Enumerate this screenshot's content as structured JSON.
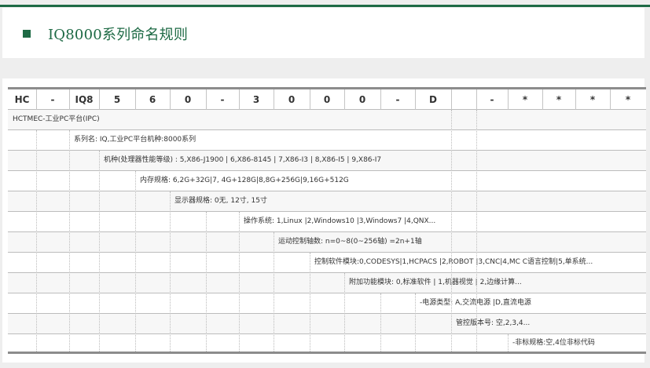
{
  "title": "IQ8000系列命名规则",
  "header_codes": [
    "HC",
    "-",
    "IQ8",
    "5",
    "6",
    "0",
    "-",
    "3",
    "0",
    "0",
    "0",
    "-",
    "D",
    "",
    "-",
    "*",
    "*",
    "*",
    "*"
  ],
  "descriptions": [
    "HCTMEC-工业PC平台(IPC)",
    "系列名: IQ,工业PC平台机种:8000系列",
    "机种(处理器性能等级) : 5,X86-J1900 | 6,X86-8145 | 7,X86-I3 | 8,X86-I5 | 9,X86-I7",
    "内存规格: 6,2G+32G|7, 4G+128G|8,8G+256G|9,16G+512G",
    "显示器规格: 0无, 12寸, 15寸",
    "操作系统: 1,Linux |2,Windows10 |3,Windows7 |4,QNX...",
    "运动控制轴数: n=0~8(0~256轴) =2n+1轴",
    "控制软件模块:0,CODESYS|1,HCPACS |2,ROBOT |3,CNC|4,MC C语言控制|5,单系统...",
    "附加功能模块: 0,标准软件 | 1,机器视觉 | 2,边缘计算...",
    "-电源类型: A,交流电源 |D,直流电源",
    "管控版本号: 空,2,3,4...",
    "-非标规格:空,4位非标代码"
  ]
}
